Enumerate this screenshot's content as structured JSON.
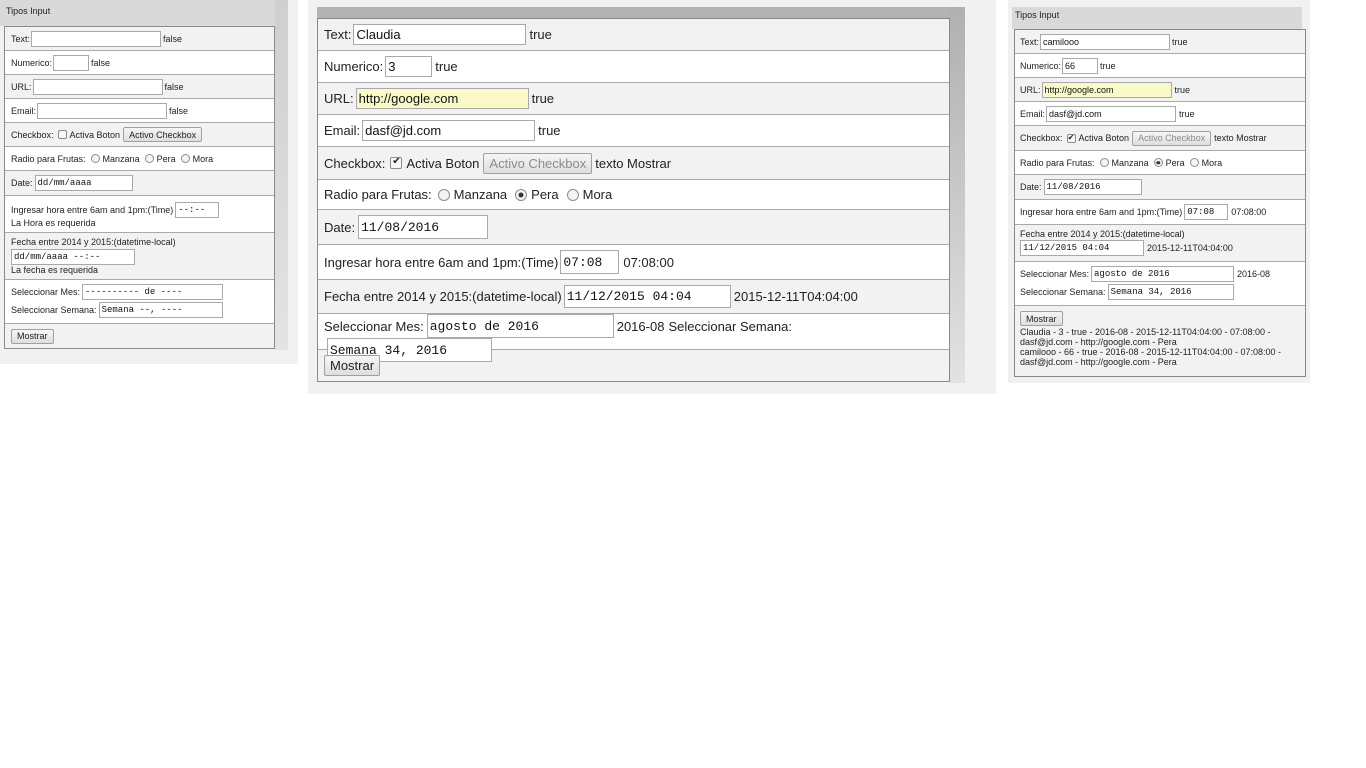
{
  "panel1": {
    "header": "Tipos Input",
    "text_label": "Text:",
    "text_value": "",
    "text_valid": "false",
    "numeric_label": "Numerico:",
    "numeric_value": "",
    "numeric_valid": "false",
    "url_label": "URL:",
    "url_value": "",
    "url_valid": "false",
    "email_label": "Email:",
    "email_value": "",
    "email_valid": "false",
    "checkbox_label": "Checkbox:",
    "checkbox_option": "Activa Boton",
    "checkbox_checked": false,
    "checkbox_button": "Activo Checkbox",
    "radio_label": "Radio para Frutas:",
    "radio_options": [
      "Manzana",
      "Pera",
      "Mora"
    ],
    "radio_selected": "",
    "date_label": "Date:",
    "date_value": "dd/mm/aaaa",
    "time_label": "Ingresar hora entre 6am and 1pm:(Time)",
    "time_value": "--:--",
    "time_error": "La Hora es requerida",
    "datetime_label": "Fecha entre 2014 y 2015:(datetime-local)",
    "datetime_value": "dd/mm/aaaa --:--",
    "datetime_error": "La fecha es requerida",
    "month_label": "Seleccionar Mes:",
    "month_value": "---------- de ----",
    "week_label": "Seleccionar Semana:",
    "week_value": "Semana --, ----",
    "submit_button": "Mostrar"
  },
  "panel2": {
    "text_label": "Text:",
    "text_value": "Claudia",
    "text_valid": "true",
    "numeric_label": "Numerico:",
    "numeric_value": "3",
    "numeric_valid": "true",
    "url_label": "URL:",
    "url_value": "http://google.com",
    "url_valid": "true",
    "email_label": "Email:",
    "email_value": "dasf@jd.com",
    "email_valid": "true",
    "checkbox_label": "Checkbox:",
    "checkbox_option": "Activa Boton",
    "checkbox_checked": true,
    "checkbox_button": "Activo Checkbox",
    "checkbox_text": "texto Mostrar",
    "radio_label": "Radio para Frutas:",
    "radio_options": [
      "Manzana",
      "Pera",
      "Mora"
    ],
    "radio_selected": "Pera",
    "date_label": "Date:",
    "date_value": "11/08/2016",
    "time_label": "Ingresar hora entre 6am and 1pm:(Time)",
    "time_value": "07:08",
    "time_output": "07:08:00",
    "datetime_label": "Fecha entre 2014 y 2015:(datetime-local)",
    "datetime_value": "11/12/2015 04:04",
    "datetime_output": "2015-12-11T04:04:00",
    "month_label": "Seleccionar Mes:",
    "month_value": "agosto de 2016",
    "month_output": "2016-08",
    "week_label": "Seleccionar Semana:",
    "week_value": "Semana 34, 2016",
    "submit_button": "Mostrar"
  },
  "panel3": {
    "header": "Tipos Input",
    "text_label": "Text:",
    "text_value": "camilooo",
    "text_valid": "true",
    "numeric_label": "Numerico:",
    "numeric_value": "66",
    "numeric_valid": "true",
    "url_label": "URL:",
    "url_value": "http://google.com",
    "url_valid": "true",
    "email_label": "Email:",
    "email_value": "dasf@jd.com",
    "email_valid": "true",
    "checkbox_label": "Checkbox:",
    "checkbox_option": "Activa Boton",
    "checkbox_checked": true,
    "checkbox_button": "Activo Checkbox",
    "checkbox_text": "texto Mostrar",
    "radio_label": "Radio para Frutas:",
    "radio_options": [
      "Manzana",
      "Pera",
      "Mora"
    ],
    "radio_selected": "Pera",
    "date_label": "Date:",
    "date_value": "11/08/2016",
    "time_label": "Ingresar hora entre 6am and 1pm:(Time)",
    "time_value": "07:08",
    "time_output": "07:08:00",
    "datetime_label": "Fecha entre 2014 y 2015:(datetime-local)",
    "datetime_value": "11/12/2015 04:04",
    "datetime_output": "2015-12-11T04:04:00",
    "month_label": "Seleccionar Mes:",
    "month_value": "agosto de 2016",
    "month_output": "2016-08",
    "week_label": "Seleccionar Semana:",
    "week_value": "Semana 34, 2016",
    "submit_button": "Mostrar",
    "results": [
      "Claudia - 3 - true - 2016-08 - 2015-12-11T04:04:00 - 07:08:00 - dasf@jd.com - http://google.com - Pera",
      "camilooo - 66 - true - 2016-08 - 2015-12-11T04:04:00 - 07:08:00 - dasf@jd.com - http://google.com - Pera"
    ]
  },
  "colors": {
    "row_alt": "#f2f2f2",
    "border": "#a9a9a9",
    "url_highlight": "#fafac8",
    "panel_bg": "#f1f1f1"
  }
}
